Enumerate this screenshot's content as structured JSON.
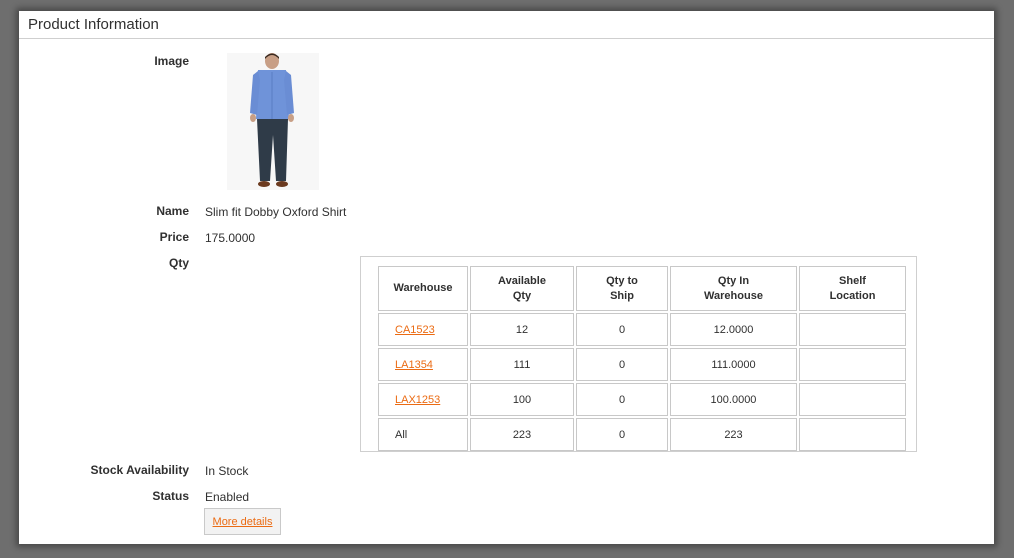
{
  "section": {
    "title": "Product Information"
  },
  "fields": {
    "image_label": "Image",
    "name_label": "Name",
    "name_value": "Slim fit Dobby Oxford Shirt",
    "price_label": "Price",
    "price_value": "175.0000",
    "qty_label": "Qty",
    "stock_label": "Stock Availability",
    "stock_value": "In Stock",
    "status_label": "Status",
    "status_value": "Enabled"
  },
  "qty_table": {
    "headers": {
      "warehouse": "Warehouse",
      "available_1": "Available",
      "available_2": "Qty",
      "toship_1": "Qty to",
      "toship_2": "Ship",
      "inwh_1": "Qty In",
      "inwh_2": "Warehouse",
      "shelf_1": "Shelf",
      "shelf_2": "Location"
    },
    "rows": [
      {
        "warehouse": "CA1523",
        "available": "12",
        "to_ship": "0",
        "in_warehouse": "12.0000",
        "shelf": ""
      },
      {
        "warehouse": "LA1354",
        "available": "111",
        "to_ship": "0",
        "in_warehouse": "111.0000",
        "shelf": ""
      },
      {
        "warehouse": "LAX1253",
        "available": "100",
        "to_ship": "0",
        "in_warehouse": "100.0000",
        "shelf": ""
      },
      {
        "warehouse": "All",
        "available": "223",
        "to_ship": "0",
        "in_warehouse": "223",
        "shelf": ""
      }
    ]
  },
  "actions": {
    "more_details": "More details"
  },
  "colors": {
    "link": "#eb6b13",
    "border": "#c8c8c8",
    "backdrop": "#6e6e6e"
  }
}
